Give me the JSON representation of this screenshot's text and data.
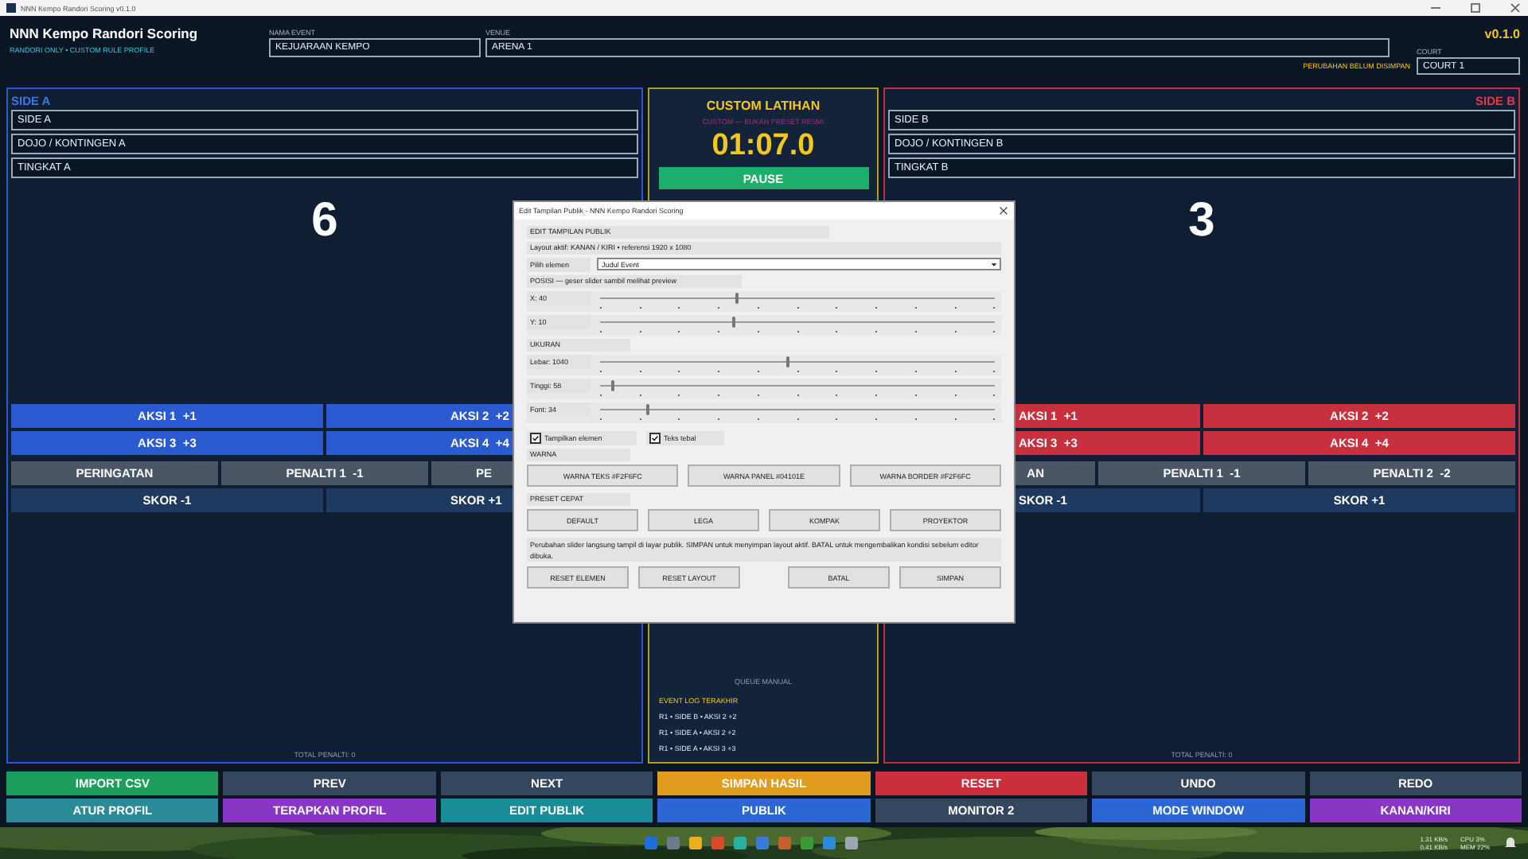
{
  "window": {
    "title": "NNN Kempo Randori Scoring v0.1.0"
  },
  "header": {
    "app_title": "NNN Kempo Randori Scoring",
    "subtitle": "RANDORI ONLY • CUSTOM RULE PROFILE",
    "version": "v0.1.0",
    "fields": [
      {
        "label": "NAMA EVENT",
        "value": "KEJUARAAN KEMPO"
      },
      {
        "label": "VENUE",
        "value": "ARENA 1"
      }
    ],
    "court": {
      "label": "COURT",
      "value": "COURT 1"
    },
    "unsaved_notice": "PERUBAHAN BELUM DISIMPAN"
  },
  "sides": [
    {
      "title": "SIDE A",
      "fields": [
        "SIDE A",
        "DOJO / KONTINGEN A",
        "TINGKAT A"
      ],
      "score": "6",
      "actions": [
        "AKSI 1  +1",
        "AKSI 2  +2",
        "AKSI 3  +3",
        "AKSI 4  +4"
      ],
      "penalties": [
        "PERINGATAN",
        "PENALTI 1  -1",
        "PE"
      ],
      "skor": [
        "SKOR -1",
        "SKOR +1"
      ],
      "total_penalty": "TOTAL PENALTI: 0"
    },
    {
      "title": "SIDE B",
      "fields": [
        "SIDE B",
        "DOJO / KONTINGEN B",
        "TINGKAT B"
      ],
      "score": "3",
      "actions": [
        "AKSI 1  +1",
        "AKSI 2  +2",
        "AKSI 3  +3",
        "AKSI 4  +4"
      ],
      "penalties": [
        "AN",
        "PENALTI 1  -1",
        "PENALTI 2  -2"
      ],
      "skor": [
        "SKOR -1",
        "SKOR +1"
      ],
      "total_penalty": "TOTAL PENALTI: 0"
    }
  ],
  "center": {
    "mode": "CUSTOM LATIHAN",
    "mode_note": "CUSTOM — BUKAN PRESET RESMI",
    "timer": "01:07.0",
    "pause_button": "PAUSE",
    "queue": "QUEUE MANUAL",
    "log_title": "EVENT LOG TERAKHIR",
    "log": [
      "R1 • SIDE B • AKSI 2 +2",
      "R1 • SIDE A • AKSI 2 +2",
      "R1 • SIDE A • AKSI 3 +3"
    ]
  },
  "toolbar": [
    [
      {
        "label": "IMPORT CSV",
        "color": "#1e9e5c"
      },
      {
        "label": "PREV",
        "color": "#34475e"
      },
      {
        "label": "NEXT",
        "color": "#34475e"
      },
      {
        "label": "SIMPAN HASIL",
        "color": "#e09c1c"
      },
      {
        "label": "RESET",
        "color": "#cc2f3c"
      },
      {
        "label": "UNDO",
        "color": "#34475e"
      },
      {
        "label": "REDO",
        "color": "#34475e"
      }
    ],
    [
      {
        "label": "ATUR PROFIL",
        "color": "#2a8a96"
      },
      {
        "label": "TERAPKAN PROFIL",
        "color": "#8a36c4"
      },
      {
        "label": "EDIT PUBLIK",
        "color": "#1a8c98"
      },
      {
        "label": "PUBLIK",
        "color": "#2b66d4"
      },
      {
        "label": "MONITOR 2",
        "color": "#34475e"
      },
      {
        "label": "MODE WINDOW",
        "color": "#2b66d4"
      },
      {
        "label": "KANAN/KIRI",
        "color": "#8a36c4"
      }
    ]
  ],
  "dialog": {
    "title": "Edit Tampilan Publik - NNN Kempo Randori Scoring",
    "heading": "EDIT TAMPILAN PUBLIK",
    "layout_info": "Layout aktif: KANAN / KIRI • referensi 1920 x 1080",
    "element_label": "Pilih elemen",
    "element_value": "Judul Event",
    "position_label": "POSISI — geser slider sambil melihat preview",
    "position_sliders": [
      {
        "label": "X: 40",
        "level": 0.35
      },
      {
        "label": "Y: 10",
        "level": 0.34
      }
    ],
    "size_label": "UKURAN",
    "size_sliders": [
      {
        "label": "Lebar: 1040",
        "level": 0.48
      },
      {
        "label": "Tinggi: 58",
        "level": 0.03
      },
      {
        "label": "Font: 34",
        "level": 0.12
      }
    ],
    "checkboxes": [
      {
        "label": "Tampilkan elemen",
        "checked": true
      },
      {
        "label": "Teks tebal",
        "checked": true
      }
    ],
    "color_label": "WARNA",
    "color_buttons": [
      "WARNA TEKS #F2F6FC",
      "WARNA PANEL #04101E",
      "WARNA BORDER #F2F6FC"
    ],
    "preset_label": "PRESET CEPAT",
    "preset_buttons": [
      "DEFAULT",
      "LEGA",
      "KOMPAK",
      "PROYEKTOR"
    ],
    "note": "Perubahan slider langsung tampil di layar publik. SIMPAN untuk menyimpan layout aktif. BATAL untuk mengembalikan kondisi sebelum editor dibuka.",
    "left_buttons": [
      "RESET ELEMEN",
      "RESET LAYOUT"
    ],
    "right_buttons": [
      "BATAL",
      "SIMPAN"
    ]
  },
  "taskbar": {
    "tray": [
      "1.31 KB/s",
      "0.41 KB/s",
      "CPU 3%",
      "MEM 22%"
    ]
  }
}
